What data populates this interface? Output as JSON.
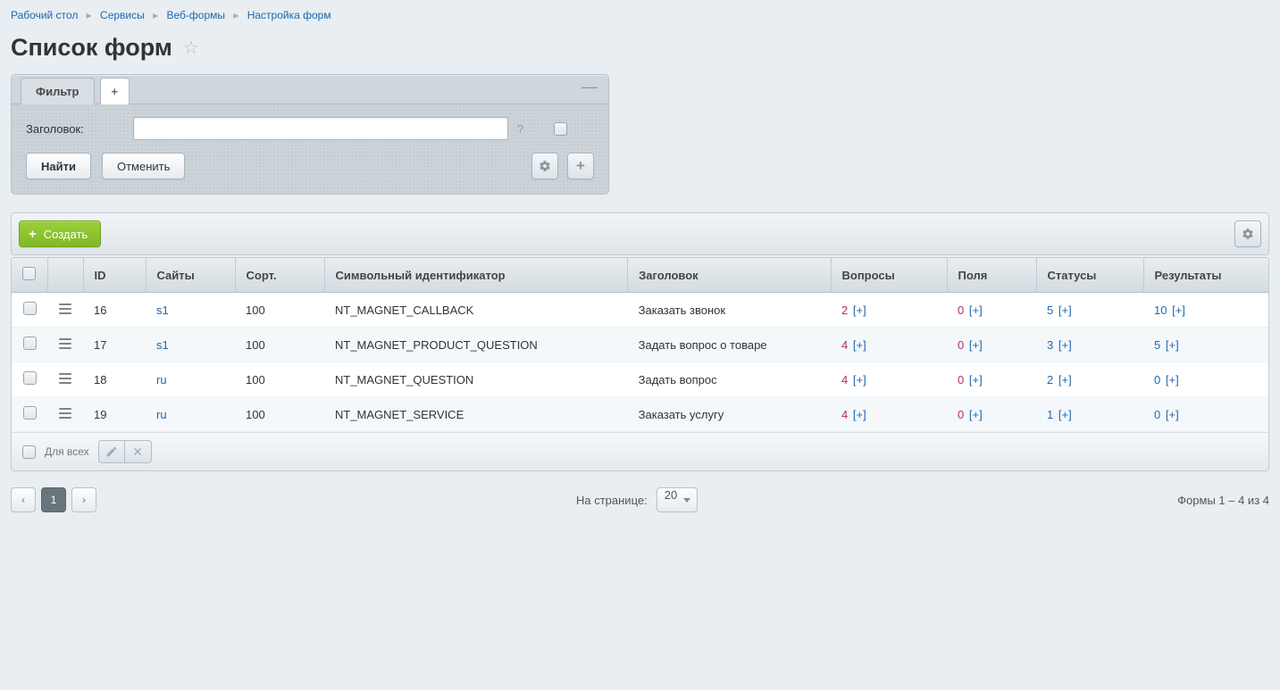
{
  "breadcrumb": [
    {
      "label": "Рабочий стол"
    },
    {
      "label": "Сервисы"
    },
    {
      "label": "Веб-формы"
    },
    {
      "label": "Настройка форм"
    }
  ],
  "page_title": "Список форм",
  "filter": {
    "tab_label": "Фильтр",
    "field_label": "Заголовок:",
    "field_value": "",
    "help": "?",
    "find_btn": "Найти",
    "cancel_btn": "Отменить"
  },
  "toolbar": {
    "create_btn": "Создать"
  },
  "table": {
    "columns": {
      "id": "ID",
      "sites": "Сайты",
      "sort": "Сорт.",
      "sid": "Символьный идентификатор",
      "title": "Заголовок",
      "questions": "Вопросы",
      "fields": "Поля",
      "statuses": "Статусы",
      "results": "Результаты"
    },
    "rows": [
      {
        "id": "16",
        "site": "s1",
        "sort": "100",
        "sid": "NT_MAGNET_CALLBACK",
        "title": "Заказать звонок",
        "questions": "2",
        "fields": "0",
        "statuses": "5",
        "results": "10"
      },
      {
        "id": "17",
        "site": "s1",
        "sort": "100",
        "sid": "NT_MAGNET_PRODUCT_QUESTION",
        "title": "Задать вопрос о товаре",
        "questions": "4",
        "fields": "0",
        "statuses": "3",
        "results": "5"
      },
      {
        "id": "18",
        "site": "ru",
        "sort": "100",
        "sid": "NT_MAGNET_QUESTION",
        "title": "Задать вопрос",
        "questions": "4",
        "fields": "0",
        "statuses": "2",
        "results": "0"
      },
      {
        "id": "19",
        "site": "ru",
        "sort": "100",
        "sid": "NT_MAGNET_SERVICE",
        "title": "Заказать услугу",
        "questions": "4",
        "fields": "0",
        "statuses": "1",
        "results": "0"
      }
    ],
    "plus_ext": "[+]",
    "for_all_label": "Для всех"
  },
  "pagination": {
    "on_page_label": "На странице:",
    "page_size": "20",
    "current": "1",
    "summary": "Формы 1 – 4 из 4"
  }
}
